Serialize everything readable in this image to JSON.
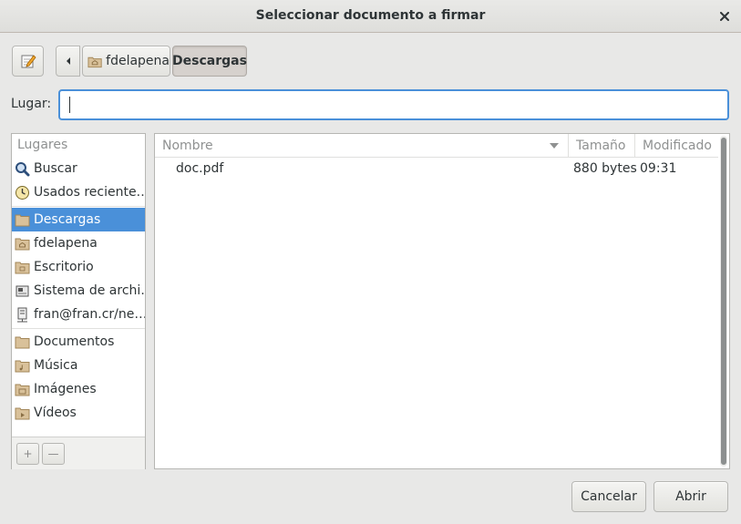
{
  "window": {
    "title": "Seleccionar documento a firmar"
  },
  "toolbar": {
    "path": [
      {
        "label": "fdelapena",
        "icon": "home-folder-icon"
      },
      {
        "label": "Descargas",
        "icon": ""
      }
    ]
  },
  "location": {
    "label": "Lugar:",
    "value": ""
  },
  "places": {
    "header": "Lugares",
    "items": [
      {
        "label": "Buscar",
        "icon": "search-icon"
      },
      {
        "label": "Usados reciente…",
        "icon": "recent-clock-icon"
      },
      {
        "label": "Descargas",
        "icon": "folder-icon",
        "selected": true
      },
      {
        "label": "fdelapena",
        "icon": "home-folder-icon"
      },
      {
        "label": "Escritorio",
        "icon": "folder-icon"
      },
      {
        "label": "Sistema de archi…",
        "icon": "drive-icon"
      },
      {
        "label": "fran@fran.cr/ne…",
        "icon": "network-drive-icon"
      },
      {
        "label": "Documentos",
        "icon": "folder-icon"
      },
      {
        "label": "Música",
        "icon": "folder-icon"
      },
      {
        "label": "Imágenes",
        "icon": "folder-icon"
      },
      {
        "label": "Vídeos",
        "icon": "folder-icon"
      }
    ],
    "add_label": "+",
    "remove_label": "—"
  },
  "files": {
    "columns": {
      "name": "Nombre",
      "size": "Tamaño",
      "modified": "Modificado"
    },
    "rows": [
      {
        "name": "doc.pdf",
        "size": "880 bytes",
        "modified": "09:31"
      }
    ]
  },
  "footer": {
    "cancel_label": "Cancelar",
    "open_label": "Abrir"
  },
  "colors": {
    "accent": "#4a90d9",
    "window_bg": "#e8e8e7"
  }
}
